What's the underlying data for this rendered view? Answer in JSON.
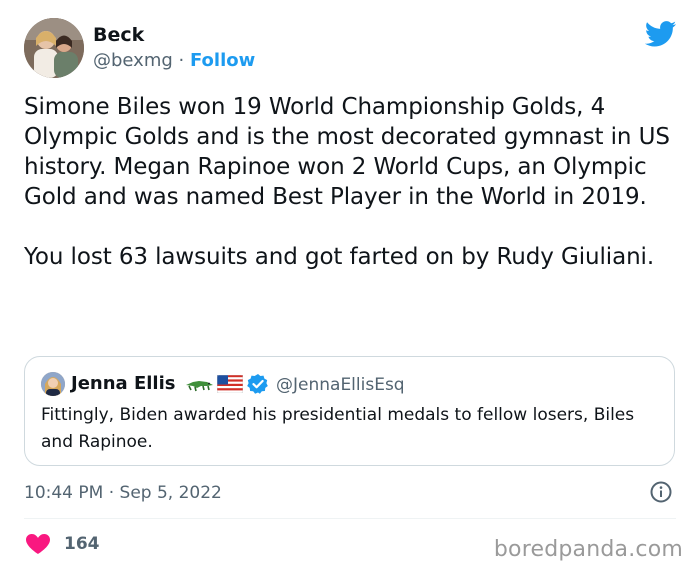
{
  "author": {
    "name": "Beck",
    "handle": "@bexmg",
    "separator": " · ",
    "follow_label": "Follow"
  },
  "tweet": {
    "text": "Simone Biles won 19 World Championship Golds, 4 Olympic Golds and is the most decorated gymnast in US history. Megan Rapinoe won 2 World Cups, an Olympic Gold and was named Best Player in the World in 2019.\n\nYou lost 63 lawsuits and got farted on by Rudy Giuliani.",
    "timestamp": "10:44 PM · Sep 5, 2022",
    "likes": "164"
  },
  "quote": {
    "name": "Jenna Ellis",
    "emoji": [
      "alligator-emoji",
      "us-flag-emoji"
    ],
    "handle": "@JennaEllisEsq",
    "text": "Fittingly, Biden awarded his presidential medals to fellow losers, Biles and Rapinoe."
  },
  "icons": {
    "platform_logo": "bird-icon",
    "verified": "verified-badge-icon",
    "info": "info-icon",
    "like": "heart-icon"
  },
  "colors": {
    "accent": "#1d9bf0",
    "like": "#f91880",
    "secondary_text": "#536471",
    "border": "#cfd9de"
  },
  "watermark": "boredpanda.com"
}
